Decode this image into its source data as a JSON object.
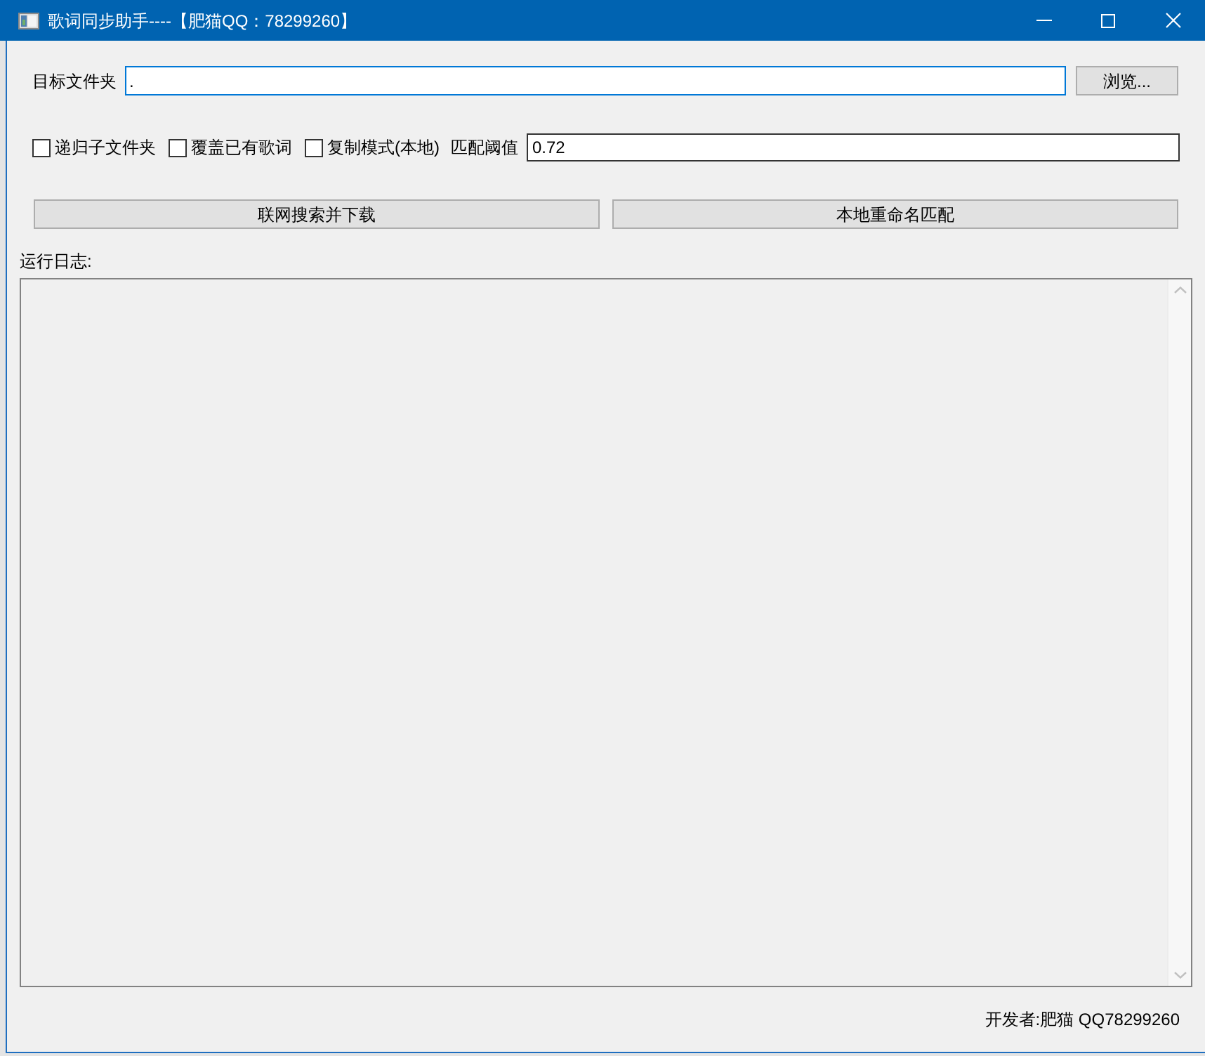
{
  "window": {
    "title": "歌词同步助手----【肥猫QQ：78299260】"
  },
  "folder": {
    "label": "目标文件夹",
    "value": ".",
    "focused": true,
    "browse_button": "浏览..."
  },
  "options": {
    "checkboxes": [
      {
        "label": "递归子文件夹",
        "checked": false
      },
      {
        "label": "覆盖已有歌词",
        "checked": false
      },
      {
        "label": "复制模式(本地)",
        "checked": false
      }
    ],
    "threshold": {
      "label": "匹配阈值",
      "value": "0.72",
      "focused": false
    }
  },
  "actions": [
    "联网搜索并下载",
    "本地重命名匹配"
  ],
  "log": {
    "label": "运行日志:"
  },
  "footer": "开发者:肥猫 QQ78299260"
}
